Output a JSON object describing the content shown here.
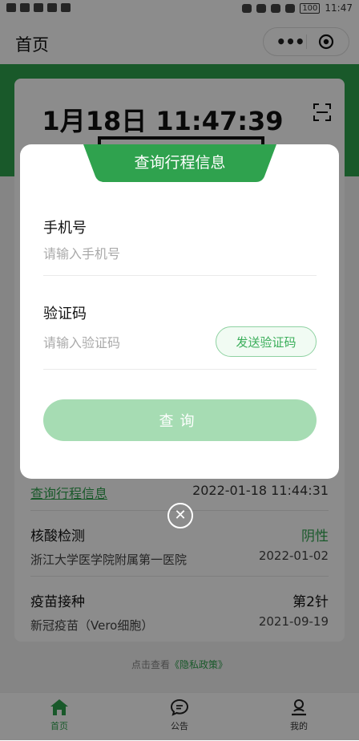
{
  "status_bar": {
    "time": "11:47",
    "battery": "100"
  },
  "header": {
    "title": "首页",
    "more_label": "•••"
  },
  "background": {
    "datetime": "1月18日 11:47:39",
    "trip_link": "查询行程信息",
    "trip_time": "2022-01-18 11:44:31",
    "nucleic": {
      "label": "核酸检测",
      "result": "阴性",
      "hospital": "浙江大学医学院附属第一医院",
      "date": "2022-01-02"
    },
    "vaccine": {
      "label": "疫苗接种",
      "dose": "第2针",
      "name": "新冠疫苗（Vero细胞）",
      "date": "2021-09-19"
    },
    "privacy_prefix": "点击查看",
    "privacy_link": "《隐私政策》"
  },
  "modal": {
    "title": "查询行程信息",
    "phone": {
      "label": "手机号",
      "placeholder": "请输入手机号",
      "value": ""
    },
    "code": {
      "label": "验证码",
      "placeholder": "请输入验证码",
      "value": ""
    },
    "send_code_label": "发送验证码",
    "query_label": "查询"
  },
  "tabs": [
    {
      "label": "首页",
      "icon": "home-icon",
      "active": true
    },
    {
      "label": "公告",
      "icon": "chat-icon",
      "active": false
    },
    {
      "label": "我的",
      "icon": "user-icon",
      "active": false
    }
  ],
  "colors": {
    "primary": "#2fa24e",
    "button_disabled": "#a6dcb3",
    "mask": "rgba(0,0,0,0.45)"
  }
}
